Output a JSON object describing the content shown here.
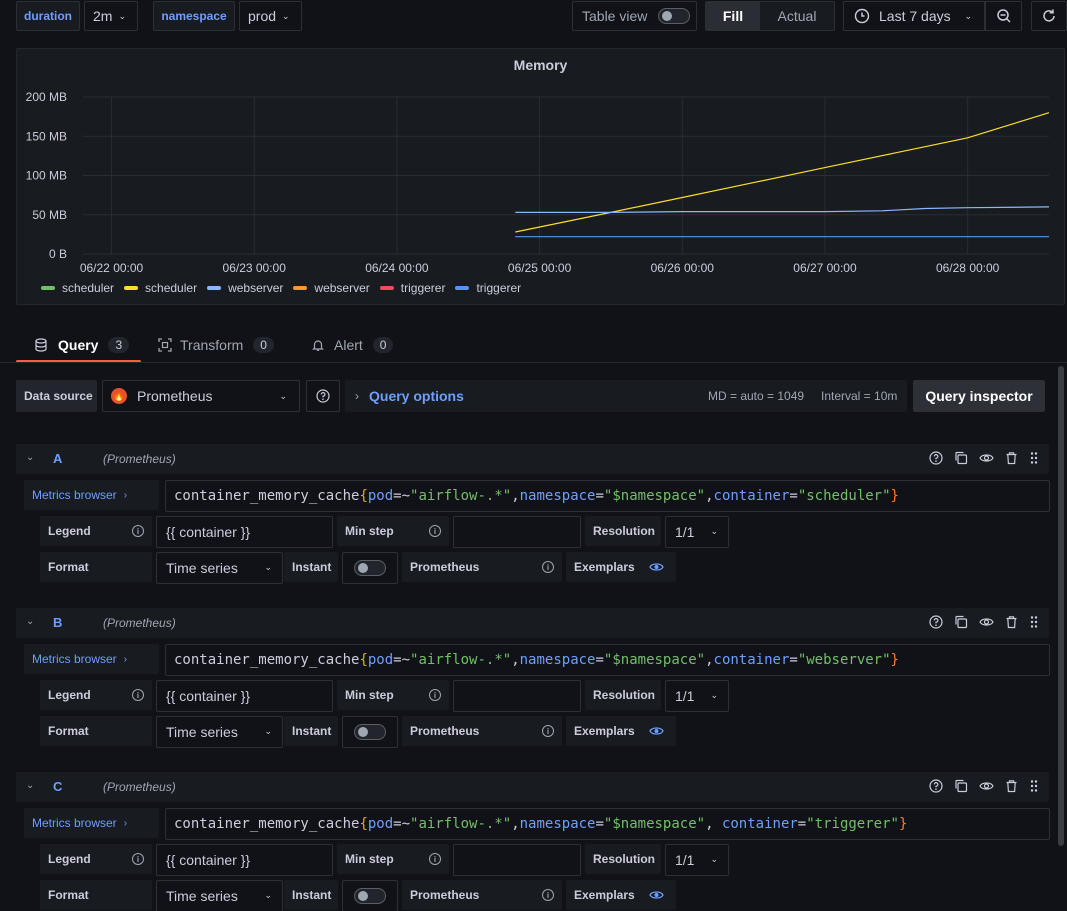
{
  "toolbar": {
    "var1_label": "duration",
    "var1_value": "2m",
    "var2_label": "namespace",
    "var2_value": "prod",
    "table_view_label": "Table view",
    "fill_label": "Fill",
    "actual_label": "Actual",
    "time_range": "Last 7 days"
  },
  "panel": {
    "title": "Memory"
  },
  "chart_data": {
    "type": "line",
    "title": "Memory",
    "y_ticks": [
      "200 MB",
      "150 MB",
      "100 MB",
      "50 MB",
      "0 B"
    ],
    "y_tick_values": [
      200,
      150,
      100,
      50,
      0
    ],
    "ylim": [
      0,
      200
    ],
    "y_unit": "MB",
    "x_ticks": [
      "06/22 00:00",
      "06/23 00:00",
      "06/24 00:00",
      "06/25 00:00",
      "06/26 00:00",
      "06/27 00:00",
      "06/28 00:00"
    ],
    "x_tick_values": [
      0,
      1,
      2,
      3,
      4,
      5,
      6
    ],
    "xlim": [
      -0.2,
      6.57
    ],
    "grid": true,
    "legend_position": "bottom-left",
    "legend": [
      {
        "name": "scheduler",
        "color": "#73bf69"
      },
      {
        "name": "scheduler",
        "color": "#fade2a"
      },
      {
        "name": "webserver",
        "color": "#8ab8ff"
      },
      {
        "name": "webserver",
        "color": "#ff9830"
      },
      {
        "name": "triggerer",
        "color": "#f2495c"
      },
      {
        "name": "triggerer",
        "color": "#5794f2"
      }
    ],
    "series": [
      {
        "name": "scheduler",
        "color": "#fade2a",
        "x": [
          2.83,
          3.5,
          4.0,
          4.5,
          5.0,
          5.5,
          6.0,
          6.57
        ],
        "y": [
          28,
          53,
          72,
          91,
          110,
          129,
          148,
          180
        ]
      },
      {
        "name": "webserver",
        "color": "#8ab8ff",
        "x": [
          2.83,
          3.5,
          4.0,
          5.0,
          5.4,
          5.7,
          6.0,
          6.57
        ],
        "y": [
          53,
          53,
          54,
          54,
          55,
          58,
          59,
          60
        ]
      },
      {
        "name": "triggerer",
        "color": "#5794f2",
        "x": [
          2.83,
          4.0,
          5.0,
          6.0,
          6.57
        ],
        "y": [
          22,
          22,
          22,
          22,
          22
        ]
      }
    ]
  },
  "tabs": [
    {
      "label": "Query",
      "count": "3"
    },
    {
      "label": "Transform",
      "count": "0"
    },
    {
      "label": "Alert",
      "count": "0"
    }
  ],
  "datasource": {
    "label": "Data source",
    "value": "Prometheus",
    "query_options": "Query options",
    "md": "MD = auto = 1049",
    "interval": "Interval = 10m",
    "inspector": "Query inspector"
  },
  "queries": [
    {
      "ref": "A",
      "ds": "(Prometheus)",
      "metrics_browser": "Metrics browser",
      "expr": {
        "metric": "container_memory_cache",
        "pod": "\"airflow-.*\"",
        "ns": "\"$namespace\"",
        "sep": ",",
        "container": "\"scheduler\""
      },
      "legend_label": "Legend",
      "legend_value": "{{ container }}",
      "min_step_label": "Min step",
      "resolution_label": "Resolution",
      "resolution_value": "1/1",
      "format_label": "Format",
      "format_value": "Time series",
      "instant_label": "Instant",
      "type_label": "Prometheus",
      "exemplars_label": "Exemplars"
    },
    {
      "ref": "B",
      "ds": "(Prometheus)",
      "metrics_browser": "Metrics browser",
      "expr": {
        "metric": "container_memory_cache",
        "pod": "\"airflow-.*\"",
        "ns": "\"$namespace\"",
        "sep": ",",
        "container": "\"webserver\""
      },
      "legend_label": "Legend",
      "legend_value": "{{ container }}",
      "min_step_label": "Min step",
      "resolution_label": "Resolution",
      "resolution_value": "1/1",
      "format_label": "Format",
      "format_value": "Time series",
      "instant_label": "Instant",
      "type_label": "Prometheus",
      "exemplars_label": "Exemplars"
    },
    {
      "ref": "C",
      "ds": "(Prometheus)",
      "metrics_browser": "Metrics browser",
      "expr": {
        "metric": "container_memory_cache",
        "pod": "\"airflow-.*\"",
        "ns": "\"$namespace\"",
        "sep": ", ",
        "container": "\"triggerer\""
      },
      "legend_label": "Legend",
      "legend_value": "{{ container }}",
      "min_step_label": "Min step",
      "resolution_label": "Resolution",
      "resolution_value": "1/1",
      "format_label": "Format",
      "format_value": "Time series",
      "instant_label": "Instant",
      "type_label": "Prometheus",
      "exemplars_label": "Exemplars"
    }
  ]
}
